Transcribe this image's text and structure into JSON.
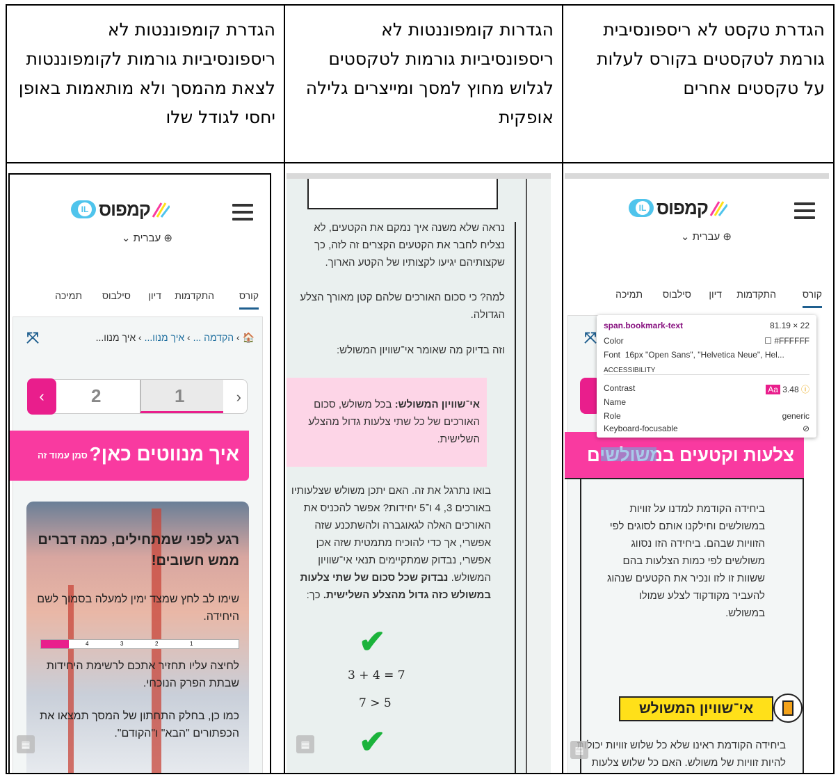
{
  "headers": {
    "col_right": "הגדרת טקסט לא ריספונסיבית גורמת לטקסטים בקורס לעלות על טקסטים אחרים",
    "col_middle": "הגדרות קומפוננטות לא ריספונסיביות גורמות לטקסטים לגלוש מחוץ למסך ומייצרים גלילה אופקית",
    "col_left": "הגדרת קומפוננטות לא ריספונסיביות גורמות לקומפוננטות לצאת מהמסך ולא מותאמות באופן יחסי לגודל שלו"
  },
  "app": {
    "logo_word": "קמפוס",
    "logo_badge": "IL",
    "language": "עברית",
    "language_caret": "⌄",
    "tabs": [
      "קורס",
      "התקדמות",
      "דיון",
      "סילבוס",
      "תמיכה"
    ]
  },
  "shot_left": {
    "breadcrumb_home": "🏠",
    "breadcrumb_1": "הקדמה ...",
    "breadcrumb_2": "איך מנוו...",
    "breadcrumb_3": "איך מנוו...",
    "pager_1": "1",
    "pager_2": "2",
    "banner": "איך מנווטים כאן?",
    "bookmark": "סמן עמוד זה",
    "card_title": "רגע לפני שמתחילים, כמה דברים ממש חשובים!",
    "card_p1": "שימו לב לחץ שמצד ימין למעלה בסמוך לשם היחידה.",
    "card_p2": "לחיצה עליו תחזיר אתכם לרשימת היחידות שבתת הפרק הנוכחי.",
    "card_p3": "כמו כן, בחלק התחתון של המסך תמצאו את הכפתורים \"הבא\" ו\"הקודם\".",
    "mini_nums": [
      "1",
      "2",
      "3",
      "4"
    ]
  },
  "shot_middle": {
    "p1": "נראה שלא משנה איך נמקם את הקטעים, לא נצליח לחבר את הקטעים הקצרים זה לזה, כך שקצותיהם יגיעו לקצותיו של הקטע הארוך.",
    "p2": "למה? כי סכום האורכים שלהם קטן מאורך הצלע הגדולה.",
    "p3": "וזה בדיוק מה שאומר אי־שוויון המשולש:",
    "callout_bold": "אי־שוויון המשולש:",
    "callout_text": "בכל משולש, סכום האורכים של כל שתי צלעות גדול מהצלע השלישית.",
    "p4": "בואו נתרגל את זה. האם יתכן משולש שצלעותיו באורכים 3, 4 ו־5 יחידות? אפשר להכניס את האורכים האלה לגאוגברה ולהשתכנע שזה אפשרי, אך כדי להוכיח מתמטית שזה אכן אפשרי, נבדוק שמתקיימים תנאי אי־שוויון המשולש.",
    "p4_bold": "נבדוק שכל סכום של שתי צלעות במשולש כזה גדול מהצלע השלישית.",
    "p4_end": "כך:",
    "eq1": "3 + 4 = 7",
    "eq2": "7 > 5",
    "check": "✔"
  },
  "shot_right": {
    "tooltip_selector": "span.bookmark-text",
    "tooltip_size": "81.19 × 22",
    "tooltip_color_label": "Color",
    "tooltip_color_value": "#FFFFFF",
    "tooltip_font_label": "Font",
    "tooltip_font_value": "16px \"Open Sans\", \"Helvetica Neue\", Hel...",
    "tooltip_access": "ACCESSIBILITY",
    "tooltip_contrast_label": "Contrast",
    "tooltip_contrast_badge": "Aa",
    "tooltip_contrast_value": "3.48",
    "tooltip_name_label": "Name",
    "tooltip_role_label": "Role",
    "tooltip_role_value": "generic",
    "tooltip_keyboard_label": "Keyboard-focusable",
    "banner": "צלעות וקטעים במשולשים",
    "body": "ביחידה הקודמת למדנו על זוויות במשולשים וחילקנו אותם לסוגים לפי הזוויות שבהם. ביחידה הזו נסווג משולשים לפי כמות הצלעות בהם ששוות זו לזו ונכיר את הקטעים שנהוג להעביר מקודקוד לצלע שמולו במשולש.",
    "heading": "אי־שוויון המשולש",
    "body2": "ביחידה הקודמת ראינו שלא כל שלוש זוויות יכולות להיות זוויות של משולש. האם כל שלוש צלעות"
  },
  "colors": {
    "pink": "#f93aa0",
    "teal": "#4fc4ec",
    "yellow": "#ffe019",
    "green": "#1bb33b"
  }
}
